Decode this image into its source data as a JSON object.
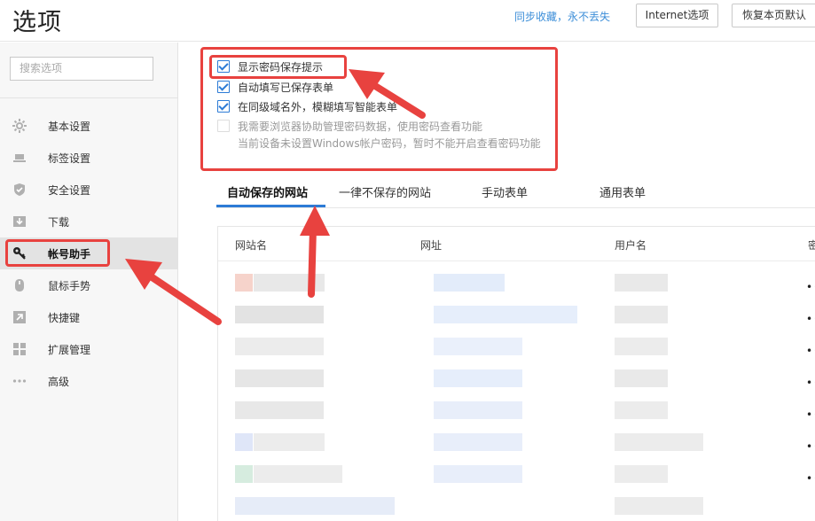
{
  "header": {
    "title": "选项",
    "sync_text": "同步收藏，永不丢失",
    "internet_button": "Internet选项",
    "restore_button": "恢复本页默认"
  },
  "sidebar": {
    "search_placeholder": "搜索选项",
    "items": [
      {
        "label": "基本设置",
        "icon": "gear-icon"
      },
      {
        "label": "标签设置",
        "icon": "laptop-icon"
      },
      {
        "label": "安全设置",
        "icon": "shield-check-icon"
      },
      {
        "label": "下载",
        "icon": "download-icon"
      },
      {
        "label": "帐号助手",
        "icon": "key-icon",
        "active": true
      },
      {
        "label": "鼠标手势",
        "icon": "mouse-icon"
      },
      {
        "label": "快捷键",
        "icon": "shortcut-arrow-icon"
      },
      {
        "label": "扩展管理",
        "icon": "grid-icon"
      },
      {
        "label": "高级",
        "icon": "more-dots-icon"
      }
    ]
  },
  "settings": {
    "options": [
      {
        "label": "显示密码保存提示",
        "checked": true,
        "enabled": true
      },
      {
        "label": "自动填写已保存表单",
        "checked": true,
        "enabled": true
      },
      {
        "label": "在同级域名外，模糊填写智能表单",
        "checked": true,
        "enabled": true
      },
      {
        "label": "我需要浏览器协助管理密码数据，使用密码查看功能",
        "checked": false,
        "enabled": false
      }
    ],
    "note": "当前设备未设置Windows帐户密码，暂时不能开启查看密码功能"
  },
  "tabs": [
    {
      "label": "自动保存的网站",
      "active": true
    },
    {
      "label": "一律不保存的网站"
    },
    {
      "label": "手动表单"
    },
    {
      "label": "通用表单"
    }
  ],
  "table": {
    "columns": [
      "网站名",
      "网址",
      "用户名",
      "密"
    ],
    "password_mask": "••"
  },
  "colors": {
    "accent": "#2c7bd6",
    "highlight_red": "#e8423f",
    "sync_link": "#3c8ed8"
  }
}
